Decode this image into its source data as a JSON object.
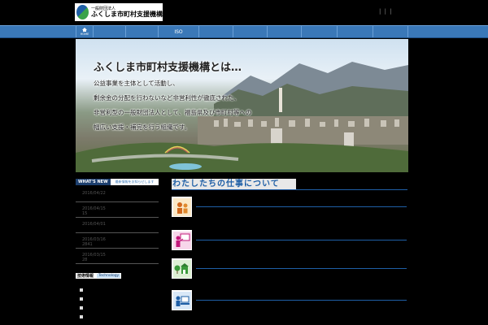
{
  "logo": {
    "small_text": "一般財団法人",
    "name": "ふくしま市町村支援機構"
  },
  "header": {
    "links": "| | |"
  },
  "nav": {
    "home": "HOME",
    "iso": "ISO"
  },
  "hero": {
    "title": "ふくしま市町村支援機構とは…",
    "lines": [
      "公益事業を主体として活動し、",
      "剰余金の分配を行わないなど非営利性が徹底された、",
      "非営利型の一般財団法人として、福島県及び市町村等への",
      "幅広い支援・補完を行う組織です。"
    ]
  },
  "whats_new": {
    "title": "WHAT'S NEW",
    "subtitle": "最新情報をお知らせします",
    "items": [
      {
        "date": "2016/04/22",
        "extra": ""
      },
      {
        "date": "2016/04/15",
        "extra": "15"
      },
      {
        "date": "2016/04/01",
        "extra": ""
      },
      {
        "date": "2016/03/16",
        "extra": "2841"
      },
      {
        "date": "2016/03/15",
        "extra": "28"
      }
    ]
  },
  "tech": {
    "title": "技術情報",
    "subtitle": "Technology"
  },
  "work": {
    "title": "わたしたちの仕事について"
  },
  "colors": {
    "nav": "#3a78b8",
    "accent": "#1f5fa6",
    "background": "#000000"
  }
}
